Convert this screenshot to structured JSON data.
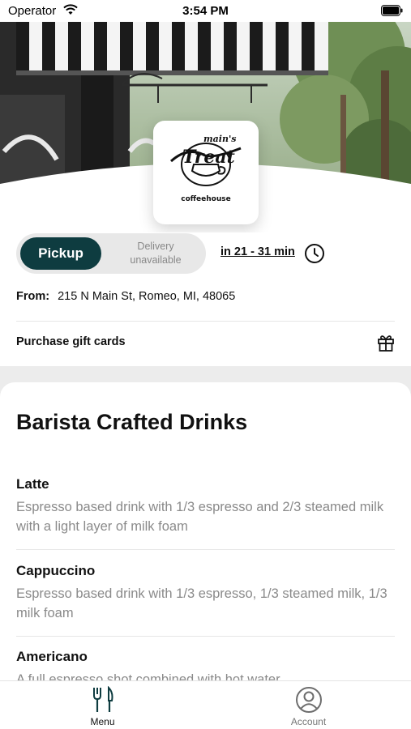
{
  "status_bar": {
    "carrier": "Operator",
    "time": "3:54 PM"
  },
  "store": {
    "logo_top_text": "main's",
    "logo_main_text": "Treat",
    "logo_sub_text": "coffeehouse"
  },
  "order_mode": {
    "pickup_label": "Pickup",
    "delivery_label": "Delivery unavailable",
    "eta_label": "in 21 - 31 min"
  },
  "location": {
    "from_label": "From:",
    "address": "215 N Main St, Romeo, MI, 48065"
  },
  "gift_cards": {
    "label": "Purchase gift cards"
  },
  "menu": {
    "section_title": "Barista Crafted Drinks",
    "items": [
      {
        "name": "Latte",
        "description": "Espresso based drink with 1/3 espresso and 2/3 steamed milk with a light layer of milk foam"
      },
      {
        "name": "Cappuccino",
        "description": "Espresso based drink with 1/3 espresso, 1/3 steamed milk, 1/3 milk foam"
      },
      {
        "name": "Americano",
        "description": "A full espresso shot combined with hot water"
      }
    ]
  },
  "tabbar": {
    "menu_label": "Menu",
    "account_label": "Account"
  },
  "icons": {
    "clock": "clock-icon",
    "gift": "gift-icon",
    "menu": "fork-knife-icon",
    "account": "user-circle-icon"
  },
  "colors": {
    "accent": "#0e3c40",
    "muted_text": "#8a8a8a"
  }
}
